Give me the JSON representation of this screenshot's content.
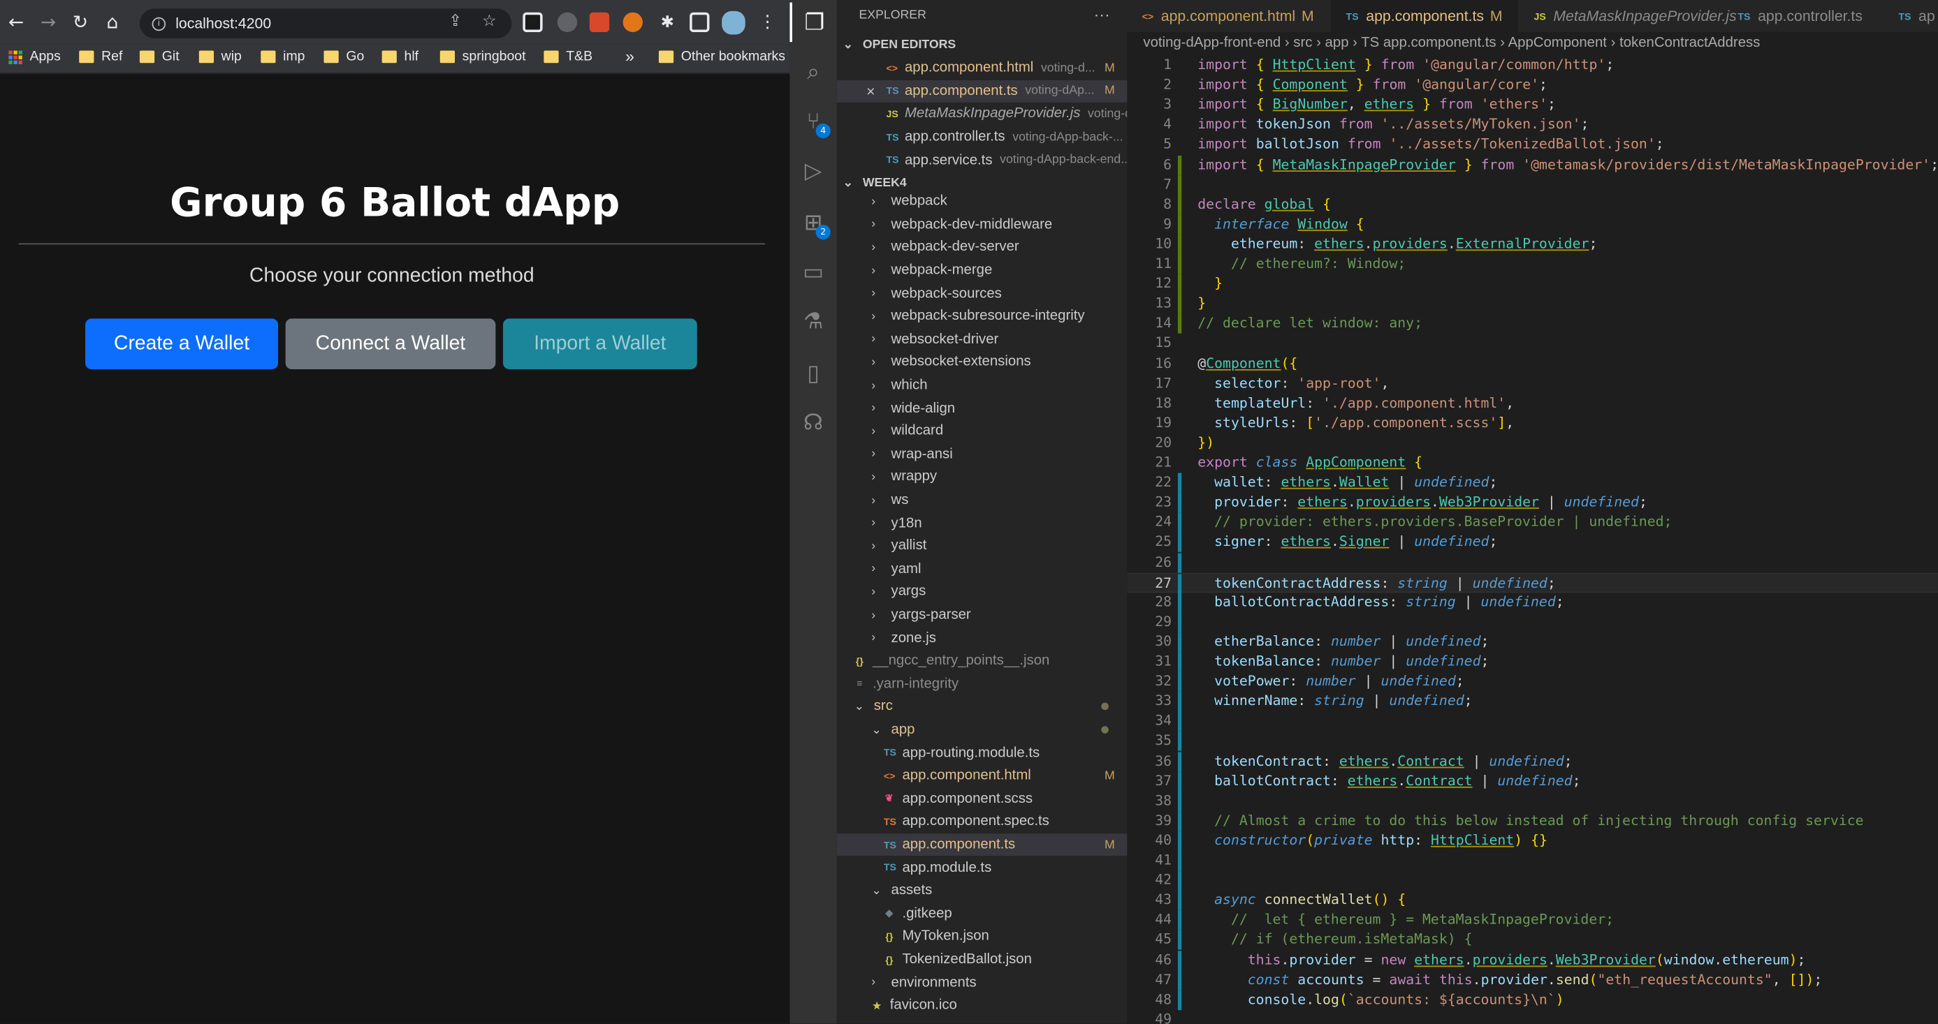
{
  "browser": {
    "url": "localhost:4200",
    "bookmarks": [
      "Apps",
      "Ref",
      "Git",
      "wip",
      "imp",
      "Go",
      "hlf",
      "springboot",
      "T&B",
      "Other bookmarks"
    ],
    "more": "»",
    "page": {
      "title": "Group 6 Ballot dApp",
      "subtitle": "Choose your connection method",
      "buttons": [
        {
          "label": "Create a Wallet",
          "color": "#0d6efd"
        },
        {
          "label": "Connect a Wallet",
          "color": "#6c757d"
        },
        {
          "label": "Import a Wallet",
          "color": "#1b8599"
        }
      ]
    }
  },
  "activity_bar": {
    "icons": [
      "explorer-icon",
      "search-icon",
      "source-control-icon",
      "run-debug-icon",
      "extensions-icon",
      "remote-explorer-icon",
      "testing-icon",
      "notebook-icon",
      "accounts-icon"
    ],
    "badges": {
      "source_control": "4",
      "extensions": "2"
    }
  },
  "explorer": {
    "title": "EXPLORER",
    "more": "···",
    "open_editors_label": "OPEN EDITORS",
    "open_editors": [
      {
        "icon": "<>",
        "icon_color": "#e37933",
        "name": "app.component.html",
        "desc": "voting-d...",
        "mark": "M",
        "color": "#e2c08d",
        "active": false
      },
      {
        "icon": "TS",
        "icon_color": "#519aba",
        "name": "app.component.ts",
        "desc": "voting-dAp...",
        "mark": "M",
        "color": "#e2c08d",
        "active": true
      },
      {
        "icon": "JS",
        "icon_color": "#cbcb41",
        "name": "MetaMaskInpageProvider.js",
        "desc": "voting-d...",
        "mark": "",
        "color": "#aaaaaa",
        "active": false
      },
      {
        "icon": "TS",
        "icon_color": "#519aba",
        "name": "app.controller.ts",
        "desc": "voting-dApp-back-...",
        "mark": "",
        "color": "#cccccc",
        "active": false
      },
      {
        "icon": "TS",
        "icon_color": "#519aba",
        "name": "app.service.ts",
        "desc": "voting-dApp-back-end...",
        "mark": "",
        "color": "#cccccc",
        "active": false
      }
    ],
    "workspace_label": "WEEK4",
    "tree": [
      {
        "type": "folder",
        "name": "webpack",
        "indent": 1
      },
      {
        "type": "folder",
        "name": "webpack-dev-middleware",
        "indent": 1
      },
      {
        "type": "folder",
        "name": "webpack-dev-server",
        "indent": 1
      },
      {
        "type": "folder",
        "name": "webpack-merge",
        "indent": 1
      },
      {
        "type": "folder",
        "name": "webpack-sources",
        "indent": 1
      },
      {
        "type": "folder",
        "name": "webpack-subresource-integrity",
        "indent": 1
      },
      {
        "type": "folder",
        "name": "websocket-driver",
        "indent": 1
      },
      {
        "type": "folder",
        "name": "websocket-extensions",
        "indent": 1
      },
      {
        "type": "folder",
        "name": "which",
        "indent": 1
      },
      {
        "type": "folder",
        "name": "wide-align",
        "indent": 1
      },
      {
        "type": "folder",
        "name": "wildcard",
        "indent": 1
      },
      {
        "type": "folder",
        "name": "wrap-ansi",
        "indent": 1
      },
      {
        "type": "folder",
        "name": "wrappy",
        "indent": 1
      },
      {
        "type": "folder",
        "name": "ws",
        "indent": 1
      },
      {
        "type": "folder",
        "name": "y18n",
        "indent": 1
      },
      {
        "type": "folder",
        "name": "yallist",
        "indent": 1
      },
      {
        "type": "folder",
        "name": "yaml",
        "indent": 1
      },
      {
        "type": "folder",
        "name": "yargs",
        "indent": 1
      },
      {
        "type": "folder",
        "name": "yargs-parser",
        "indent": 1
      },
      {
        "type": "folder",
        "name": "zone.js",
        "indent": 1
      },
      {
        "type": "file",
        "icon": "{}",
        "icon_color": "#cbcb41",
        "name": "__ngcc_entry_points__.json",
        "indent": 0,
        "color": "#8c8c8c"
      },
      {
        "type": "file",
        "icon": "≡",
        "icon_color": "#8c8c8c",
        "name": ".yarn-integrity",
        "indent": 0,
        "color": "#8c8c8c"
      },
      {
        "type": "open",
        "name": "src",
        "indent": 0,
        "color": "#e2c08d",
        "dot": true
      },
      {
        "type": "open",
        "name": "app",
        "indent": 1,
        "color": "#e2c08d",
        "dot": true
      },
      {
        "type": "file",
        "icon": "TS",
        "icon_color": "#519aba",
        "name": "app-routing.module.ts",
        "indent": 2
      },
      {
        "type": "file",
        "icon": "<>",
        "icon_color": "#e37933",
        "name": "app.component.html",
        "indent": 2,
        "color": "#e2c08d",
        "mark": "M"
      },
      {
        "type": "file",
        "icon": "❦",
        "icon_color": "#f55385",
        "name": "app.component.scss",
        "indent": 2
      },
      {
        "type": "file",
        "icon": "TS",
        "icon_color": "#e37933",
        "name": "app.component.spec.ts",
        "indent": 2
      },
      {
        "type": "file",
        "icon": "TS",
        "icon_color": "#519aba",
        "name": "app.component.ts",
        "indent": 2,
        "color": "#e2c08d",
        "mark": "M",
        "selected": true
      },
      {
        "type": "file",
        "icon": "TS",
        "icon_color": "#519aba",
        "name": "app.module.ts",
        "indent": 2
      },
      {
        "type": "open",
        "name": "assets",
        "indent": 1
      },
      {
        "type": "file",
        "icon": "◆",
        "icon_color": "#6d8086",
        "name": ".gitkeep",
        "indent": 2
      },
      {
        "type": "file",
        "icon": "{}",
        "icon_color": "#cbcb41",
        "name": "MyToken.json",
        "indent": 2
      },
      {
        "type": "file",
        "icon": "{}",
        "icon_color": "#cbcb41",
        "name": "TokenizedBallot.json",
        "indent": 2
      },
      {
        "type": "folder",
        "name": "environments",
        "indent": 1
      },
      {
        "type": "file",
        "icon": "★",
        "icon_color": "#cbcb41",
        "name": "favicon.ico",
        "indent": 1
      }
    ]
  },
  "editor": {
    "tabs": [
      {
        "icon": "<>",
        "icon_color": "#e37933",
        "label": "app.component.html",
        "mark": "M",
        "active": false,
        "italic": false
      },
      {
        "icon": "TS",
        "icon_color": "#519aba",
        "label": "app.component.ts",
        "mark": "M",
        "active": true,
        "italic": false
      },
      {
        "icon": "JS",
        "icon_color": "#cbcb41",
        "label": "MetaMaskInpageProvider.js",
        "mark": "",
        "active": false,
        "italic": true
      },
      {
        "icon": "TS",
        "icon_color": "#519aba",
        "label": "app.controller.ts",
        "mark": "",
        "active": false,
        "italic": false
      },
      {
        "icon": "TS",
        "icon_color": "#519aba",
        "label": "ap",
        "mark": "",
        "active": false,
        "italic": false
      }
    ],
    "breadcrumb": [
      "voting-dApp-front-end",
      "src",
      "app",
      "TS app.component.ts",
      "AppComponent",
      "tokenContractAddress"
    ],
    "current_line": 27,
    "lines": [
      "import { HttpClient } from '@angular/common/http';",
      "import { Component } from '@angular/core';",
      "import { BigNumber, ethers } from 'ethers';",
      "import tokenJson from '../assets/MyToken.json';",
      "import ballotJson from '../assets/TokenizedBallot.json';",
      "import { MetaMaskInpageProvider } from '@metamask/providers/dist/MetaMaskInpageProvider';",
      "",
      "declare global {",
      "  interface Window {",
      "    ethereum: ethers.providers.ExternalProvider;",
      "    // ethereum?: Window;",
      "  }",
      "}",
      "// declare let window: any;",
      "",
      "@Component({",
      "  selector: 'app-root',",
      "  templateUrl: './app.component.html',",
      "  styleUrls: ['./app.component.scss'],",
      "})",
      "export class AppComponent {",
      "  wallet: ethers.Wallet | undefined;",
      "  provider: ethers.providers.Web3Provider | undefined;",
      "  // provider: ethers.providers.BaseProvider | undefined;",
      "  signer: ethers.Signer | undefined;",
      "",
      "  tokenContractAddress: string | undefined;",
      "  ballotContractAddress: string | undefined;",
      "",
      "  etherBalance: number | undefined;",
      "  tokenBalance: number | undefined;",
      "  votePower: number | undefined;",
      "  winnerName: string | undefined;",
      "",
      "",
      "  tokenContract: ethers.Contract | undefined;",
      "  ballotContract: ethers.Contract | undefined;",
      "",
      "  // Almost a crime to do this below instead of injecting through config service",
      "  constructor(private http: HttpClient) {}",
      "",
      "",
      "  async connectWallet() {",
      "    //  let { ethereum } = MetaMaskInpageProvider;",
      "    // if (ethereum.isMetaMask) {",
      "      this.provider = new ethers.providers.Web3Provider(window.ethereum);",
      "      const accounts = await this.provider.send(\"eth_requestAccounts\", []);",
      "      console.log(`accounts: ${accounts}\\n`)",
      ""
    ]
  }
}
